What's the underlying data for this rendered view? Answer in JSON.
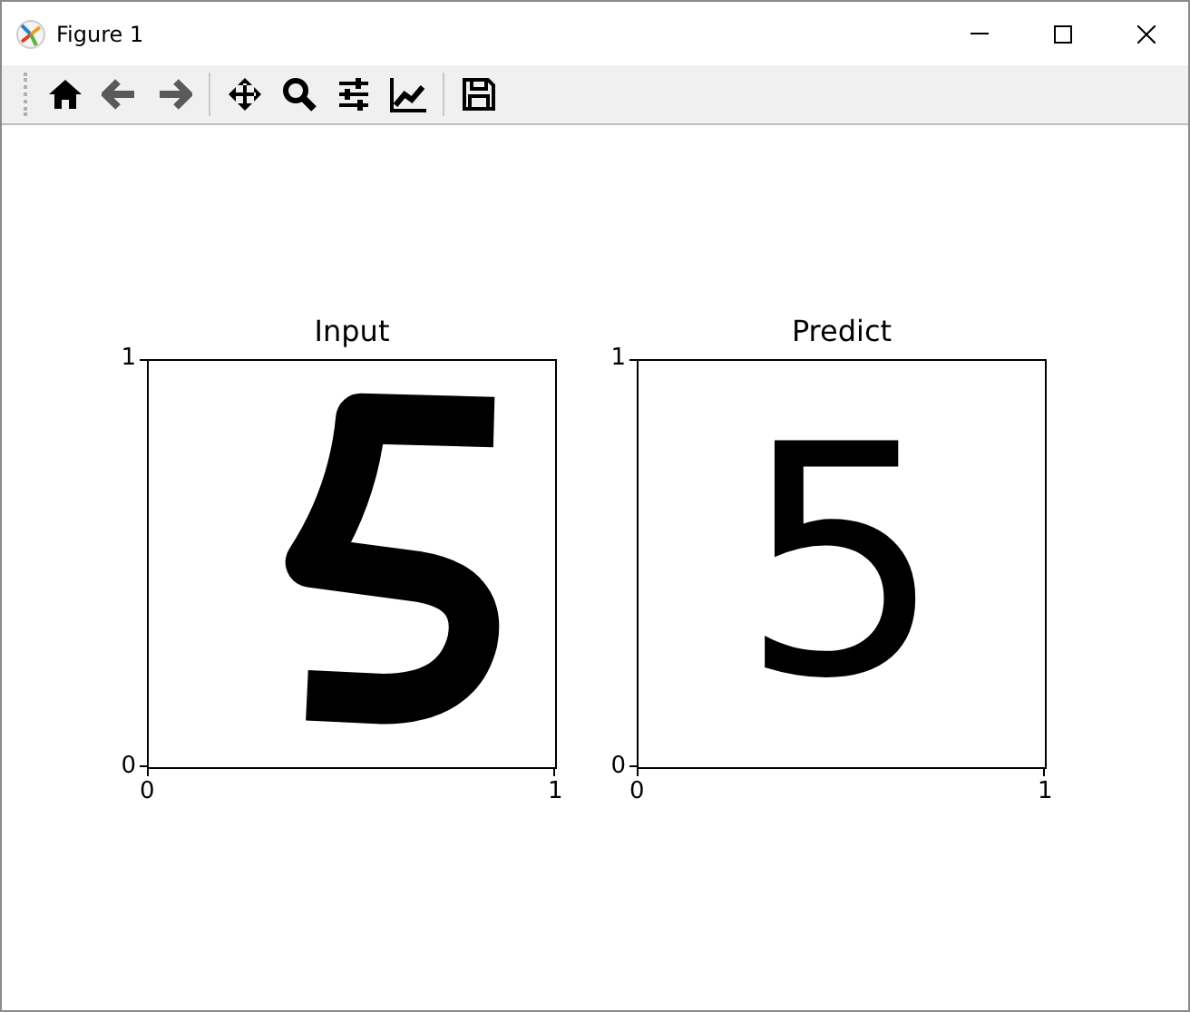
{
  "window": {
    "title": "Figure 1"
  },
  "panels": [
    {
      "title": "Input",
      "kind": "image",
      "y_tick_labels": [
        "1",
        "0"
      ],
      "x_tick_labels": [
        "0",
        "1"
      ]
    },
    {
      "title": "Predict",
      "kind": "text",
      "text": "5",
      "y_tick_labels": [
        "1",
        "0"
      ],
      "x_tick_labels": [
        "0",
        "1"
      ]
    }
  ]
}
